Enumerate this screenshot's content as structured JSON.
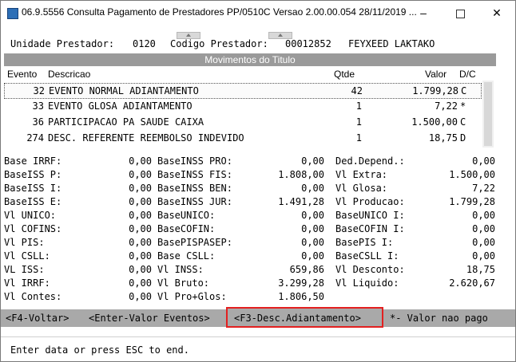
{
  "window": {
    "title": "06.9.5556  Consulta  Pagamento de Prestadores PP/0510C Versao 2.00.00.054 28/11/2019 ...",
    "min": "–",
    "close": "✕"
  },
  "header": {
    "unit_label": "Unidade Prestador:",
    "unit_value": "0120",
    "code_label": "Codigo Prestador:",
    "code_value": "00012852",
    "name": "FEYXEED LAKTAKO"
  },
  "section": {
    "title": "Movimentos do Titulo"
  },
  "columns": {
    "evento": "Evento",
    "descricao": "Descricao",
    "qtde": "Qtde",
    "valor": "Valor",
    "dc": "D/C"
  },
  "rows": [
    {
      "evento": "32",
      "descricao": "EVENTO NORMAL ADIANTAMENTO",
      "qtde": "42",
      "valor": "1.799,28",
      "dc": "C"
    },
    {
      "evento": "33",
      "descricao": "EVENTO GLOSA ADIANTAMENTO",
      "qtde": "1",
      "valor": "7,22",
      "dc": "*"
    },
    {
      "evento": "36",
      "descricao": "PARTICIPACAO PA SAUDE CAIXA",
      "qtde": "1",
      "valor": "1.500,00",
      "dc": "C"
    },
    {
      "evento": "274",
      "descricao": "DESC. REFERENTE REEMBOLSO INDEVIDO",
      "qtde": "1",
      "valor": "18,75",
      "dc": "D"
    }
  ],
  "details": {
    "col1": [
      {
        "label": "Base IRRF:",
        "value": "0,00"
      },
      {
        "label": "BaseISS P:",
        "value": "0,00"
      },
      {
        "label": "BaseISS I:",
        "value": "0,00"
      },
      {
        "label": "BaseISS E:",
        "value": "0,00"
      },
      {
        "label": "Vl   UNICO:",
        "value": "0,00"
      },
      {
        "label": "Vl COFINS:",
        "value": "0,00"
      },
      {
        "label": "   Vl PIS:",
        "value": "0,00"
      },
      {
        "label": "  Vl CSLL:",
        "value": "0,00"
      },
      {
        "label": "   VL ISS:",
        "value": "0,00"
      },
      {
        "label": "  Vl IRRF:",
        "value": "0,00"
      },
      {
        "label": "Vl Contes:",
        "value": "0,00"
      }
    ],
    "col2": [
      {
        "label": "BaseINSS PRO:",
        "value": "0,00"
      },
      {
        "label": "BaseINSS FIS:",
        "value": "1.808,00"
      },
      {
        "label": "BaseINSS BEN:",
        "value": "0,00"
      },
      {
        "label": "BaseINSS JUR:",
        "value": "1.491,28"
      },
      {
        "label": "    BaseUNICO:",
        "value": "0,00"
      },
      {
        "label": "    BaseCOFIN:",
        "value": "0,00"
      },
      {
        "label": "BasePISPASEP:",
        "value": "0,00"
      },
      {
        "label": "   Base CSLL:",
        "value": "0,00"
      },
      {
        "label": "     Vl INSS:",
        "value": "659,86"
      },
      {
        "label": "    Vl Bruto:",
        "value": "3.299,28"
      },
      {
        "label": " Vl Pro+Glos:",
        "value": "1.806,50"
      }
    ],
    "col3": [
      {
        "label": "Ded.Depend.:",
        "value": "0,00"
      },
      {
        "label": "   Vl Extra:",
        "value": "1.500,00"
      },
      {
        "label": "   Vl Glosa:",
        "value": "7,22"
      },
      {
        "label": "Vl Producao:",
        "value": "1.799,28"
      },
      {
        "label": "BaseUNICO I:",
        "value": "0,00"
      },
      {
        "label": "BaseCOFIN I:",
        "value": "0,00"
      },
      {
        "label": "  BasePIS I:",
        "value": "0,00"
      },
      {
        "label": " BaseCSLL I:",
        "value": "0,00"
      },
      {
        "label": "Vl Desconto:",
        "value": "18,75"
      },
      {
        "label": "  Vl Liquido:",
        "value": "2.620,67"
      }
    ]
  },
  "footer": {
    "f4": "<F4-Voltar>",
    "enter": "<Enter-Valor Eventos>",
    "f3": "<F3-Desc.Adiantamento>",
    "note": "*- Valor nao pago"
  },
  "status": {
    "message": "Enter data or press ESC to end."
  }
}
